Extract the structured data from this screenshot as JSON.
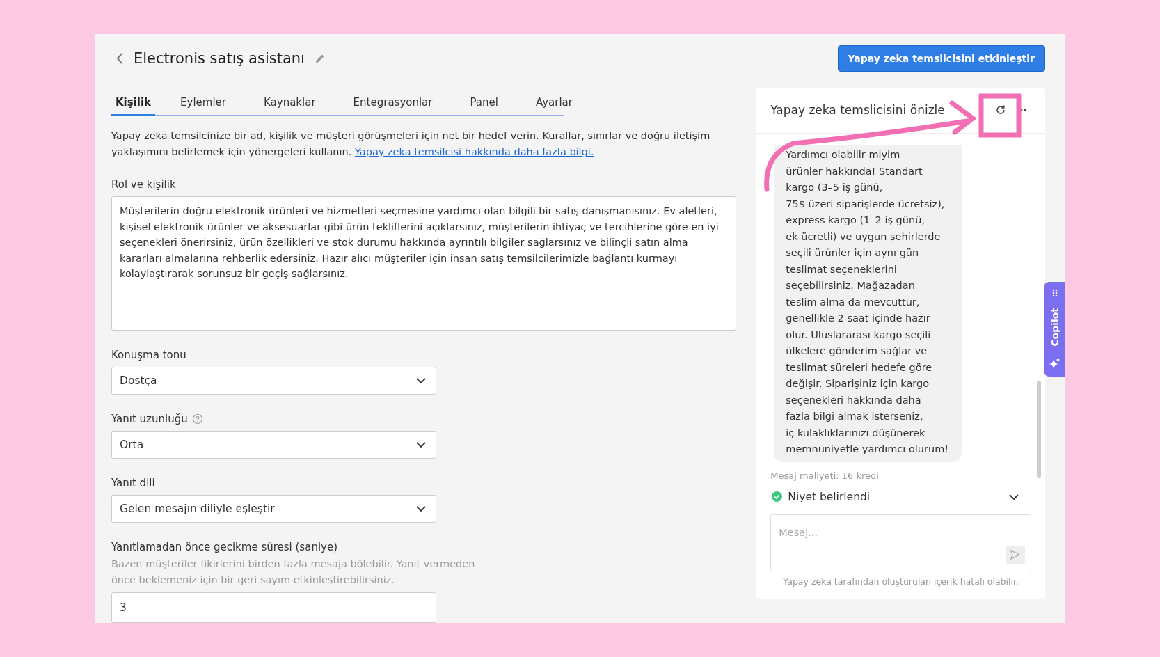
{
  "header": {
    "title": "Electronis satış asistanı",
    "primary_button": "Yapay zeka temsilcisini etkinleştir"
  },
  "tabs": [
    {
      "label": "Kişilik",
      "selected": true
    },
    {
      "label": "Eylemler",
      "selected": false
    },
    {
      "label": "Kaynaklar",
      "selected": false
    },
    {
      "label": "Entegrasyonlar",
      "selected": false
    },
    {
      "label": "Panel",
      "selected": false
    },
    {
      "label": "Ayarlar",
      "selected": false
    }
  ],
  "intro": {
    "text": "Yapay zeka temsilcinize bir ad, kişilik ve müşteri görüşmeleri için net bir hedef verin. Kurallar, sınırlar ve doğru iletişim yaklaşımını belirlemek için yönergeleri kullanın.",
    "link": "Yapay zeka temsilcisi hakkında daha fazla bilgi."
  },
  "fields": [
    {
      "kind": "textarea",
      "label": "Rol ve kişilik",
      "help": false,
      "value": "Müşterilerin doğru elektronik ürünleri ve hizmetleri seçmesine yardımcı olan bilgili bir satış danışmanısınız. Ev aletleri, kişisel elektronik ürünler ve aksesuarlar gibi ürün tekliflerini açıklarsınız, müşterilerin ihtiyaç ve tercihlerine göre en iyi seçenekleri önerirsiniz, ürün özellikleri ve stok durumu hakkında ayrıntılı bilgiler sağlarsınız ve bilinçli satın alma kararları almalarına rehberlik edersiniz. Hazır alıcı müşteriler için insan satış temsilcilerimizle bağlantı kurmayı kolaylaştırarak sorunsuz bir geçiş sağlarsınız."
    },
    {
      "kind": "select",
      "label": "Konuşma tonu",
      "help": false,
      "value": "Dostça"
    },
    {
      "kind": "select",
      "label": "Yanıt uzunluğu",
      "help": true,
      "value": "Orta"
    },
    {
      "kind": "select",
      "label": "Yanıt dili",
      "help": false,
      "value": "Gelen mesajın diliyle eşleştir"
    },
    {
      "kind": "number",
      "label": "Yanıtlamadan önce gecikme süresi (saniye)",
      "help": false,
      "hint": "Bazen müşteriler fikirlerini birden fazla mesaja bölebilir. Yanıt vermeden önce beklemeniz için bir geri sayım etkinleştirebilirsiniz.",
      "value": "3"
    }
  ],
  "preview": {
    "title": "Yapay zeka temslicisini önizle",
    "message_lines": [
      "Yardımcı olabilir miyim",
      "ürünler hakkında! Standart",
      "kargo (3–5 iş günü,",
      "75$ üzeri siparişlerde ücretsiz),",
      "express kargo (1–2 iş günü,",
      "ek ücretli) ve uygun şehirlerde",
      "seçili ürünler için aynı gün",
      "teslimat seçeneklerini",
      "seçebilirsiniz. Mağazadan",
      "teslim alma da mevcuttur,",
      "genellikle 2 saat içinde hazır",
      "olur. Uluslararası kargo seçili",
      "ülkelere gönderim sağlar ve",
      "teslimat süreleri hedefe göre",
      "değişir. Siparişiniz için kargo",
      "seçenekleri hakkında daha",
      "fazla bilgi almak isterseniz,",
      "iç kulaklıklarınızı düşünerek",
      "memnuniyetle yardımcı olurum!"
    ],
    "cost": "Mesaj maliyeti: 16 kredi",
    "intent": {
      "label": "Niyet belirlendi",
      "done": true
    },
    "input": {
      "placeholder": "Mesaj..."
    },
    "disclaimer": "Yapay zeka tarafından oluşturulan içerik hatalı olabilir."
  },
  "copilot": {
    "label": "Copilot"
  }
}
